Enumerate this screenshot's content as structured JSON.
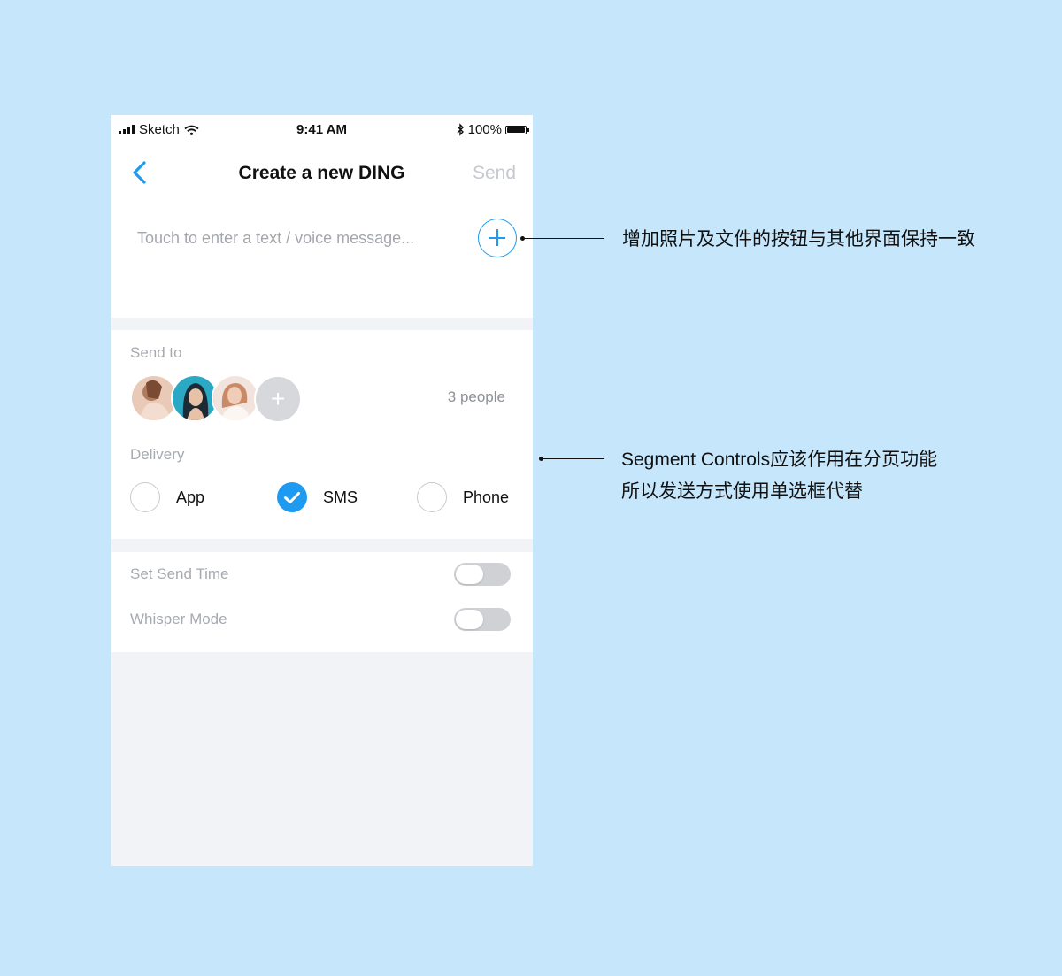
{
  "statusbar": {
    "carrier": "Sketch",
    "time": "9:41 AM",
    "battery": "100%"
  },
  "navbar": {
    "title": "Create a new DING",
    "send_label": "Send"
  },
  "compose": {
    "placeholder": "Touch to enter a text / voice message..."
  },
  "send_to": {
    "label": "Send to",
    "recipients": [
      "recipient-1",
      "recipient-2",
      "recipient-3"
    ],
    "add_symbol": "+",
    "count_text": "3 people"
  },
  "delivery": {
    "label": "Delivery",
    "options": [
      {
        "label": "App",
        "checked": false
      },
      {
        "label": "SMS",
        "checked": true
      },
      {
        "label": "Phone",
        "checked": false
      }
    ],
    "selected": "SMS"
  },
  "settings": {
    "rows": [
      {
        "label": "Set Send Time",
        "on": false
      },
      {
        "label": "Whisper Mode",
        "on": false
      }
    ]
  },
  "annotations": {
    "note1": "增加照片及文件的按钮与其他界面保持一致",
    "note2_line1": "Segment Controls应该作用在分页功能",
    "note2_line2": "所以发送方式使用单选框代替"
  },
  "colors": {
    "background": "#c6e6fb",
    "accent": "#1e9bf0",
    "muted_text": "#a6aab0"
  }
}
